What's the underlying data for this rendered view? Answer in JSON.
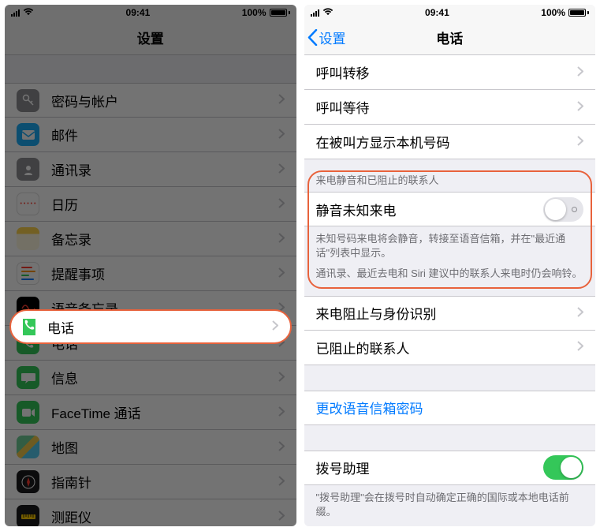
{
  "status": {
    "time": "09:41",
    "battery": "100%"
  },
  "left": {
    "title": "设置",
    "rows": [
      {
        "label": "密码与帐户"
      },
      {
        "label": "邮件"
      },
      {
        "label": "通讯录"
      },
      {
        "label": "日历"
      },
      {
        "label": "备忘录"
      },
      {
        "label": "提醒事项"
      },
      {
        "label": "语音备忘录"
      },
      {
        "label": "电话"
      },
      {
        "label": "信息"
      },
      {
        "label": "FaceTime 通话"
      },
      {
        "label": "地图"
      },
      {
        "label": "指南针"
      },
      {
        "label": "测距仪"
      }
    ]
  },
  "right": {
    "back": "设置",
    "title": "电话",
    "group1": [
      {
        "label": "呼叫转移"
      },
      {
        "label": "呼叫等待"
      },
      {
        "label": "在被叫方显示本机号码"
      }
    ],
    "silence_header": "来电静音和已阻止的联系人",
    "silence_row": "静音未知来电",
    "silence_footer1": "未知号码来电将会静音，转接至语音信箱，并在\"最近通话\"列表中显示。",
    "silence_footer2": "通讯录、最近去电和 Siri 建议中的联系人来电时仍会响铃。",
    "group2": [
      {
        "label": "来电阻止与身份识别"
      },
      {
        "label": "已阻止的联系人"
      }
    ],
    "voicemail": "更改语音信箱密码",
    "dial_assist": "拨号助理",
    "dial_footer": "\"拨号助理\"会在拨号时自动确定正确的国际或本地电话前缀。"
  }
}
